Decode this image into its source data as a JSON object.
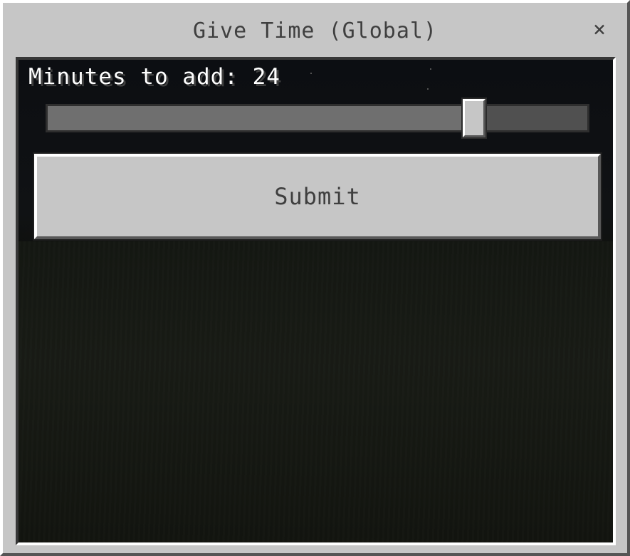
{
  "dialog": {
    "title": "Give Time (Global)",
    "close_icon": "close-icon",
    "close_glyph": "×"
  },
  "slider": {
    "label": "Minutes to add: 24",
    "value": 24,
    "fill_fraction": 0.79
  },
  "submit": {
    "label": "Submit"
  },
  "colors": {
    "panel": "#c6c6c6",
    "text_dark": "#3f3f3f",
    "text_light": "#ffffff"
  }
}
